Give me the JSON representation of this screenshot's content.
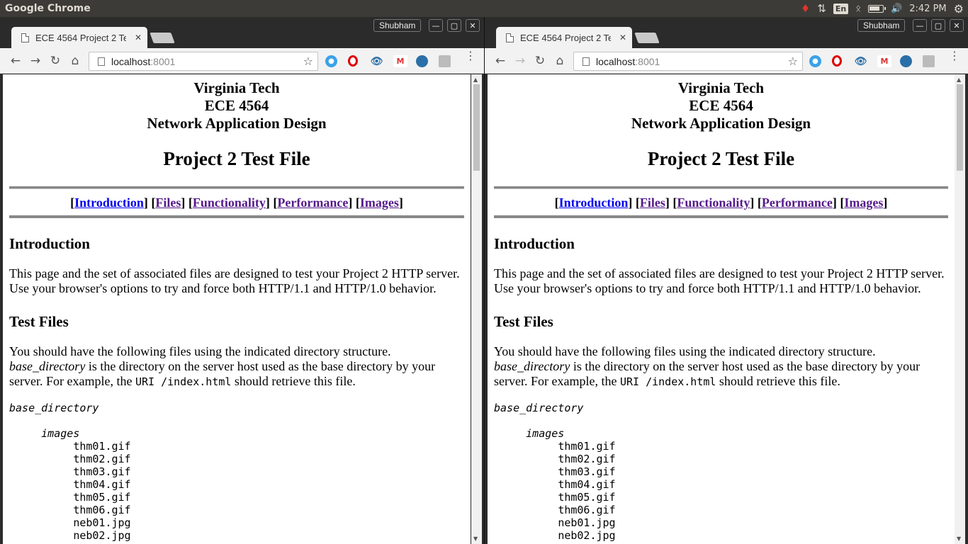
{
  "panel": {
    "app_title": "Google Chrome",
    "lang": "En",
    "time": "2:42 PM"
  },
  "browser": {
    "tab_title": "ECE 4564 Project 2 Test File",
    "profile": "Shubham",
    "url_host": "localhost",
    "url_port": ":8001"
  },
  "page": {
    "header_lines": [
      "Virginia Tech",
      "ECE 4564",
      "Network Application Design"
    ],
    "title": "Project 2 Test File",
    "nav": [
      "Introduction",
      "Files",
      "Functionality",
      "Performance",
      "Images"
    ],
    "intro_heading": "Introduction",
    "intro_text": "This page and the set of associated files are designed to test your Project 2 HTTP server. Use your browser's options to try and force both HTTP/1.1 and HTTP/1.0 behavior.",
    "files_heading": "Test Files",
    "files_text_1": "You should have the following files using the indicated directory structure.",
    "files_base_em": "base_directory",
    "files_text_2": " is the directory on the server host used as the base directory by your server. For example, the ",
    "files_code": "URI /index.html",
    "files_text_3": " should retrieve this file.",
    "tree_root": "base_directory",
    "tree_dir": "images",
    "tree_files": [
      "thm01.gif",
      "thm02.gif",
      "thm03.gif",
      "thm04.gif",
      "thm05.gif",
      "thm06.gif",
      "neb01.jpg",
      "neb02.jpg"
    ]
  },
  "colors": {
    "link": "#0000ee",
    "visited": "#551a8b",
    "panel_bg": "#3c3b37"
  }
}
